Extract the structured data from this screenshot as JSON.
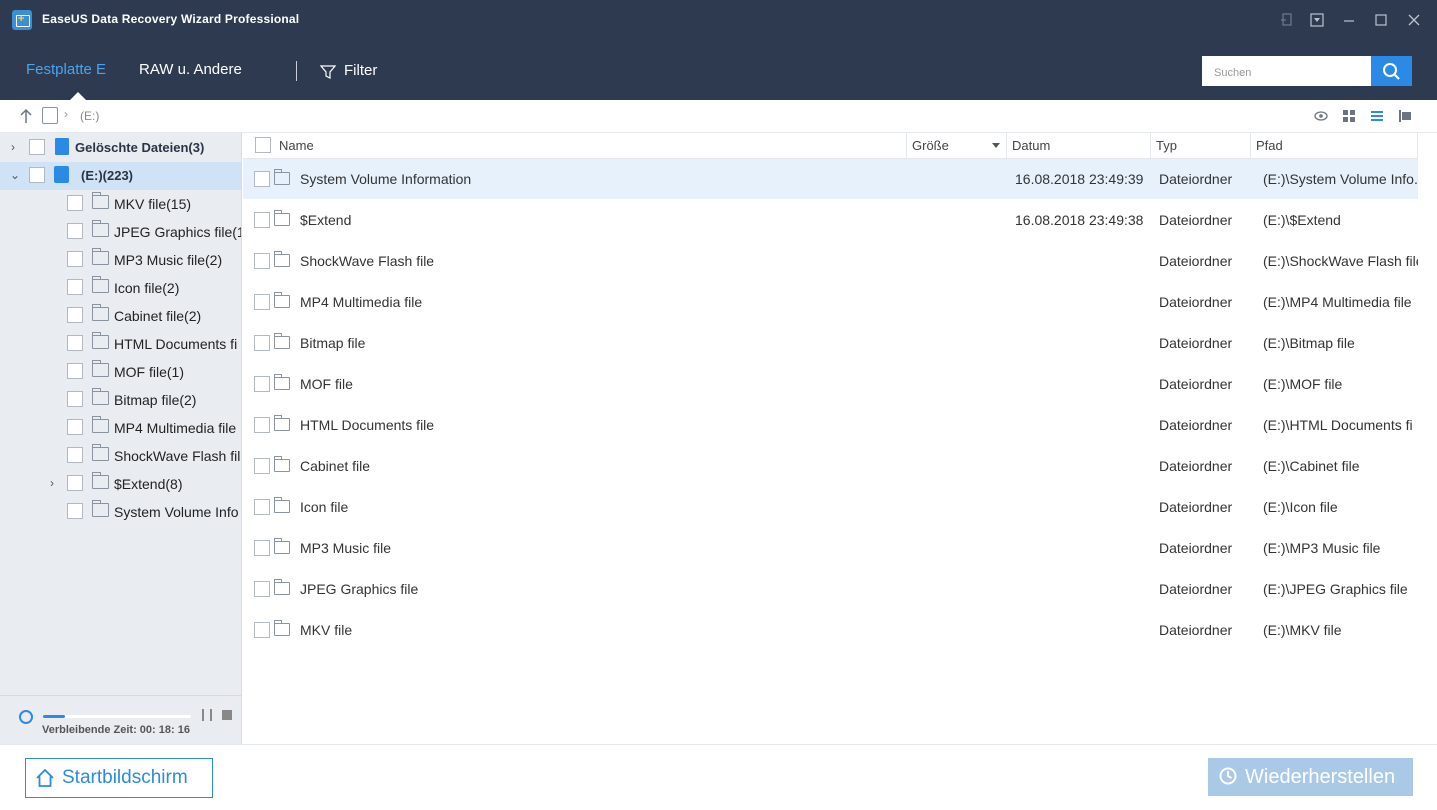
{
  "window": {
    "title": "EaseUS Data Recovery Wizard Professional",
    "controls": [
      "restore-down-icon",
      "menu-icon",
      "minimize-icon",
      "maximize-icon",
      "close-icon"
    ]
  },
  "nav": {
    "tabs": [
      {
        "label": "Festplatte E",
        "active": true
      },
      {
        "label": "RAW u. Andere",
        "active": false
      }
    ],
    "filter_label": "Filter",
    "search_placeholder": "Suchen",
    "accent_color": "#2b8ae6",
    "bar_color": "#2d3a4f"
  },
  "breadcrumb": {
    "path": "(E:)"
  },
  "tree": {
    "root_items": [
      {
        "label": "Gelöschte Dateien(3)",
        "icon": "trash-icon",
        "expanded": false
      },
      {
        "label": "(E:)(223)",
        "icon": "drive-icon",
        "expanded": true,
        "selected": true
      }
    ],
    "children": [
      {
        "label": "MKV file(15)"
      },
      {
        "label": "JPEG Graphics file(1"
      },
      {
        "label": "MP3 Music file(2)"
      },
      {
        "label": "Icon file(2)"
      },
      {
        "label": "Cabinet file(2)"
      },
      {
        "label": "HTML Documents fi"
      },
      {
        "label": "MOF file(1)"
      },
      {
        "label": "Bitmap file(2)"
      },
      {
        "label": "MP4 Multimedia file"
      },
      {
        "label": "ShockWave Flash fil"
      },
      {
        "label": "$Extend(8)",
        "expandable": true
      },
      {
        "label": "System Volume Info"
      }
    ]
  },
  "scan": {
    "progress": 0.15,
    "remaining_time": "Verbleibende Zeit: 00: 18: 16"
  },
  "table": {
    "columns": [
      "Name",
      "Größe",
      "Datum",
      "Typ",
      "Pfad"
    ],
    "rows": [
      {
        "name": "System Volume Information",
        "size": "",
        "date": "16.08.2018 23:49:39",
        "type": "Dateiordner",
        "path": "(E:)\\System Volume Info..."
      },
      {
        "name": "$Extend",
        "size": "",
        "date": "16.08.2018 23:49:38",
        "type": "Dateiordner",
        "path": "(E:)\\$Extend"
      },
      {
        "name": "ShockWave Flash file",
        "size": "",
        "date": "",
        "type": "Dateiordner",
        "path": "(E:)\\ShockWave Flash file"
      },
      {
        "name": "MP4 Multimedia file",
        "size": "",
        "date": "",
        "type": "Dateiordner",
        "path": "(E:)\\MP4 Multimedia file"
      },
      {
        "name": "Bitmap file",
        "size": "",
        "date": "",
        "type": "Dateiordner",
        "path": "(E:)\\Bitmap file"
      },
      {
        "name": "MOF file",
        "size": "",
        "date": "",
        "type": "Dateiordner",
        "path": "(E:)\\MOF file"
      },
      {
        "name": "HTML Documents file",
        "size": "",
        "date": "",
        "type": "Dateiordner",
        "path": "(E:)\\HTML Documents fi"
      },
      {
        "name": "Cabinet file",
        "size": "",
        "date": "",
        "type": "Dateiordner",
        "path": "(E:)\\Cabinet file"
      },
      {
        "name": "Icon file",
        "size": "",
        "date": "",
        "type": "Dateiordner",
        "path": "(E:)\\Icon file"
      },
      {
        "name": "MP3 Music file",
        "size": "",
        "date": "",
        "type": "Dateiordner",
        "path": "(E:)\\MP3 Music file"
      },
      {
        "name": "JPEG Graphics file",
        "size": "",
        "date": "",
        "type": "Dateiordner",
        "path": "(E:)\\JPEG Graphics file"
      },
      {
        "name": "MKV file",
        "size": "",
        "date": "",
        "type": "Dateiordner",
        "path": "(E:)\\MKV file"
      }
    ]
  },
  "bottom": {
    "home_label": "Startbildschirm",
    "recover_label": "Wiederherstellen"
  }
}
